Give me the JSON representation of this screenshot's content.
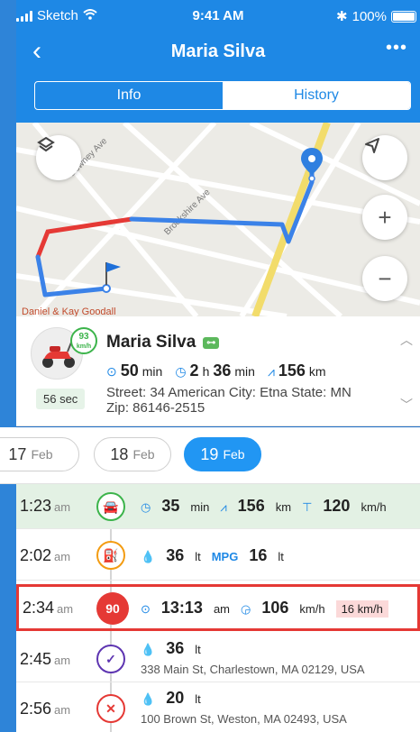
{
  "status_bar": {
    "carrier": "Sketch",
    "time": "9:41 AM",
    "battery": "100%"
  },
  "nav": {
    "back_icon": "chevron-left-icon",
    "title": "Maria Silva",
    "more_icon": "more-horizontal-icon"
  },
  "tabs": {
    "info": "Info",
    "history": "History",
    "active": "History"
  },
  "map": {
    "streets": [
      "Downey Ave",
      "Brookshire Ave"
    ],
    "footer_fragment": "Daniel & Kay Goodall"
  },
  "driver": {
    "name": "Maria Silva",
    "key_badge": "key-icon",
    "speed_badge": {
      "value": "93",
      "unit": "km/h"
    },
    "last_seen": "56 sec",
    "stats": {
      "duration_value": "50",
      "duration_unit": "min",
      "time_h": "2",
      "time_h_unit": "h",
      "time_m": "36",
      "time_m_unit": "min",
      "distance_value": "156",
      "distance_unit": "km"
    },
    "address_line1": "Street: 34 American City: Etna State: MN",
    "address_line2": "Zip: 86146-2515"
  },
  "dates": [
    {
      "day": "17",
      "month": "Feb",
      "active": false
    },
    {
      "day": "18",
      "month": "Feb",
      "active": false
    },
    {
      "day": "19",
      "month": "Feb",
      "active": true
    }
  ],
  "timeline": [
    {
      "time": "1:23",
      "ampm": "am",
      "icon": "car-icon",
      "color": "#3cb44b",
      "a_val": "35",
      "a_unit": "min",
      "b_val": "156",
      "b_unit": "km",
      "c_val": "120",
      "c_unit": "km/h"
    },
    {
      "time": "2:02",
      "ampm": "am",
      "icon": "fuel-pump-icon",
      "color": "#f39c12",
      "a_val": "36",
      "a_unit": "lt",
      "mpg_label": "MPG",
      "b_val": "16",
      "b_unit": "lt"
    },
    {
      "time": "2:34",
      "ampm": "am",
      "icon": "speed-alert-icon",
      "badge": "90",
      "color": "#e53935",
      "a_val": "13:13",
      "a_unit": "am",
      "b_val": "106",
      "b_unit": "km/h",
      "c_val": "16 km/h"
    },
    {
      "time": "2:45",
      "ampm": "am",
      "icon": "fuel-can-check-icon",
      "color": "#5e35b1",
      "a_val": "36",
      "a_unit": "lt",
      "address": "338 Main St, Charlestown, MA 02129, USA"
    },
    {
      "time": "2:56",
      "ampm": "am",
      "icon": "fuel-can-x-icon",
      "color": "#e53935",
      "a_val": "20",
      "a_unit": "lt",
      "address": "100 Brown St, Weston, MA 02493, USA"
    }
  ]
}
